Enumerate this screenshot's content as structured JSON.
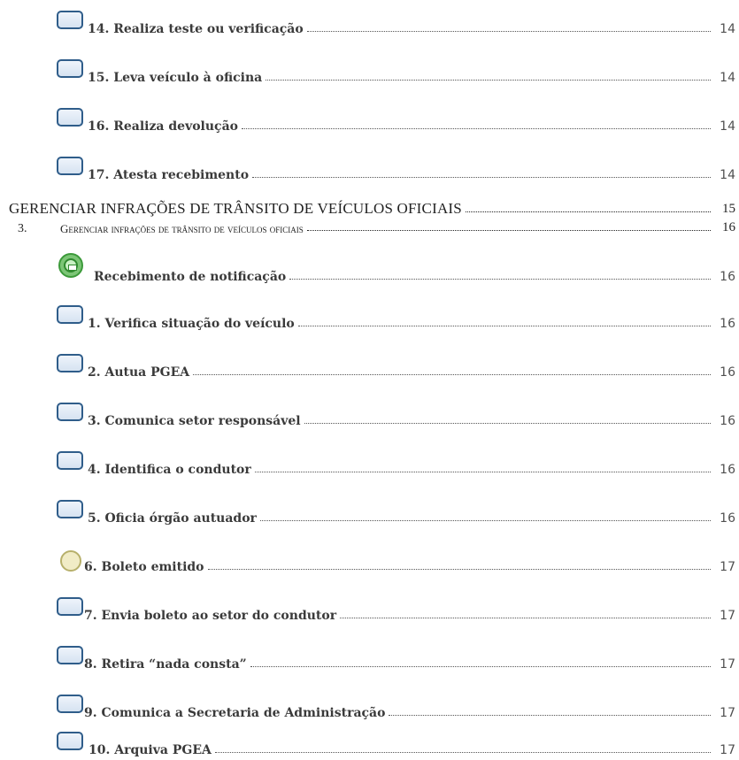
{
  "upper_items": [
    {
      "label": "14. Realiza teste ou verificação",
      "page": "14",
      "icon": "task-icon"
    },
    {
      "label": "15. Leva veículo à oficina",
      "page": "14",
      "icon": "task-icon"
    },
    {
      "label": "16. Realiza devolução",
      "page": "14",
      "icon": "task-icon"
    },
    {
      "label": "17. Atesta recebimento",
      "page": "14",
      "icon": "task-icon"
    }
  ],
  "heading1": {
    "label": "GERENCIAR INFRAÇÕES DE TRÂNSITO DE VEÍCULOS OFICIAIS",
    "page": "15"
  },
  "heading2": {
    "number": "3.",
    "label": "Gerenciar infrações de trânsito de veículos oficiais",
    "page": "16"
  },
  "start_event": {
    "label": "Recebimento de notificação",
    "page": "16",
    "icon": "message-start-event-icon",
    "color": "#7cc576"
  },
  "lower_items": [
    {
      "label": "1. Verifica situação do veículo",
      "page": "16",
      "icon": "task-icon"
    },
    {
      "label": "2. Autua PGEA",
      "page": "16",
      "icon": "task-icon"
    },
    {
      "label": "3. Comunica setor responsável",
      "page": "16",
      "icon": "task-icon"
    },
    {
      "label": "4. Identifica o condutor",
      "page": "16",
      "icon": "task-icon"
    },
    {
      "label": "5. Oficia órgão autuador",
      "page": "16",
      "icon": "task-icon"
    },
    {
      "label": "6. Boleto emitido",
      "page": "17",
      "icon": "intermediate-event-icon"
    },
    {
      "label": "7. Envia boleto ao setor do condutor",
      "page": "17",
      "icon": "task-icon"
    },
    {
      "label": "8. Retira “nada consta”",
      "page": "17",
      "icon": "task-icon"
    },
    {
      "label": "9. Comunica a Secretaria de Administração",
      "page": "17",
      "icon": "task-icon"
    },
    {
      "label": "10. Arquiva PGEA",
      "page": "17",
      "icon": "task-icon"
    }
  ],
  "colors": {
    "task_border": "#2f5d8a",
    "event_green": "#7cc576",
    "timer_fill": "#f1ecc6"
  }
}
